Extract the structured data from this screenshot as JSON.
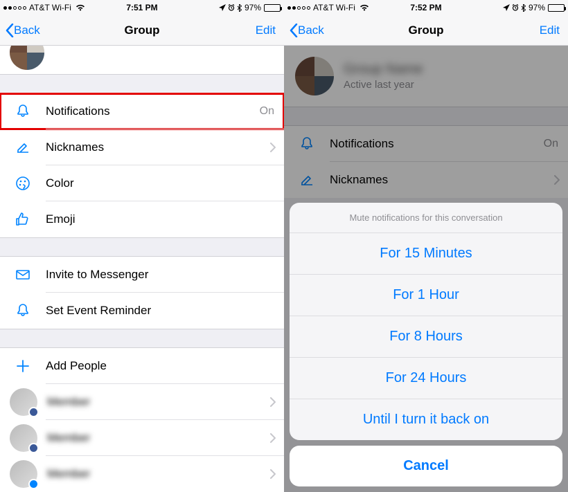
{
  "left": {
    "status": {
      "carrier": "AT&T Wi-Fi",
      "time": "7:51 PM",
      "battery_pct": "97%"
    },
    "nav": {
      "back": "Back",
      "title": "Group",
      "edit": "Edit"
    },
    "rows": {
      "notifications": {
        "label": "Notifications",
        "value": "On"
      },
      "nicknames": {
        "label": "Nicknames"
      },
      "color": {
        "label": "Color"
      },
      "emoji": {
        "label": "Emoji"
      },
      "invite": {
        "label": "Invite to Messenger"
      },
      "reminder": {
        "label": "Set Event Reminder"
      },
      "add": {
        "label": "Add People"
      }
    },
    "members": [
      "Member",
      "Member",
      "Member"
    ]
  },
  "right": {
    "status": {
      "carrier": "AT&T Wi-Fi",
      "time": "7:52 PM",
      "battery_pct": "97%"
    },
    "nav": {
      "back": "Back",
      "title": "Group",
      "edit": "Edit"
    },
    "header": {
      "name": "Group Name",
      "sub": "Active last year"
    },
    "rows": {
      "notifications": {
        "label": "Notifications",
        "value": "On"
      },
      "nicknames": {
        "label": "Nicknames"
      }
    },
    "sheet": {
      "title": "Mute notifications for this conversation",
      "opts": [
        "For 15 Minutes",
        "For 1 Hour",
        "For 8 Hours",
        "For 24 Hours",
        "Until I turn it back on"
      ],
      "cancel": "Cancel"
    }
  }
}
